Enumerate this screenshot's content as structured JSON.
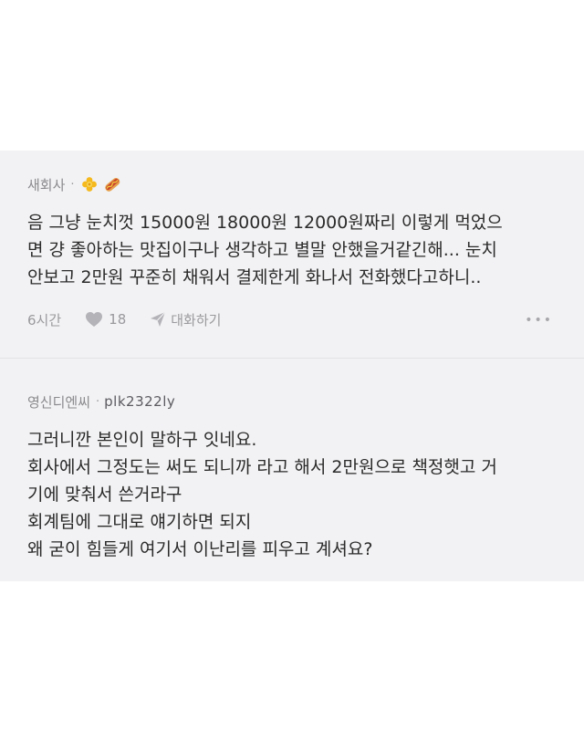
{
  "comments": [
    {
      "author": "새회사",
      "badges": [
        "flower-badge",
        "hotdog-emoji"
      ],
      "body_lines": [
        "음 그냥 눈치껏 15000원 18000원 12000원짜리 이렇게 먹었으",
        "면 걍 좋아하는 맛집이구나 생각하고 별말 안했을거같긴해... 눈치",
        "안보고 2만원 꾸준히 채워서 결제한게 화나서 전화했다고하니.."
      ],
      "time": "6시간",
      "likes": "18",
      "reply_label": "대화하기",
      "more_label": "•••"
    },
    {
      "author": "영신디엔씨",
      "handle": "plk2322ly",
      "body_lines": [
        "그러니깐 본인이 말하구 잇네요.",
        "회사에서 그정도는 써도 되니까 라고 해서 2만원으로 책정햇고 거",
        "기에 맞춰서 쓴거라구",
        "회계팀에 그대로 얘기하면 되지",
        "왜 굳이 힘들게 여기서 이난리를 피우고 계셔요?"
      ]
    }
  ]
}
